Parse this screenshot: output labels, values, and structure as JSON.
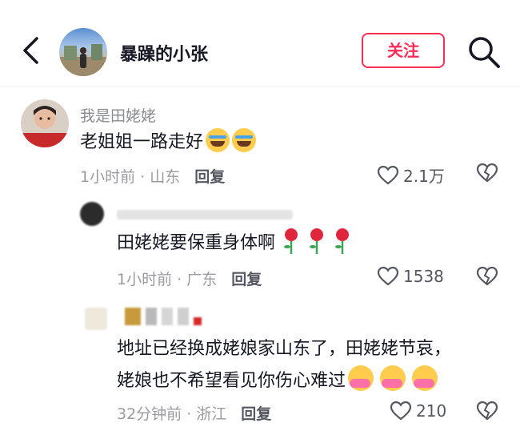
{
  "header": {
    "username": "暴躁的小张",
    "follow_label": "关注",
    "back_icon": "chevron-left-icon",
    "search_icon": "search-icon"
  },
  "comments": [
    {
      "name": "我是田姥姥",
      "text": "老姐姐一路走好",
      "emojis": [
        "crying-face",
        "crying-face"
      ],
      "time": "1小时前 · 山东",
      "reply": "回复",
      "likes": "2.1万"
    },
    {
      "name": "",
      "text": "田姥姥要保重身体啊",
      "emojis": [
        "rose",
        "rose",
        "rose"
      ],
      "time": "1小时前 · 广东",
      "reply": "回复",
      "likes": "1538"
    },
    {
      "name": "",
      "text_line1": "地址已经换成姥娘家山东了，田姥姥节哀，",
      "text_line2": "姥娘也不希望看见你伤心难过",
      "emojis": [
        "hugging-face",
        "hugging-face",
        "hugging-face"
      ],
      "time": "32分钟前 · 浙江",
      "reply": "回复",
      "likes": "210"
    }
  ],
  "colors": {
    "accent": "#fe2c55",
    "text": "#161823",
    "meta": "#9a9ba1"
  }
}
